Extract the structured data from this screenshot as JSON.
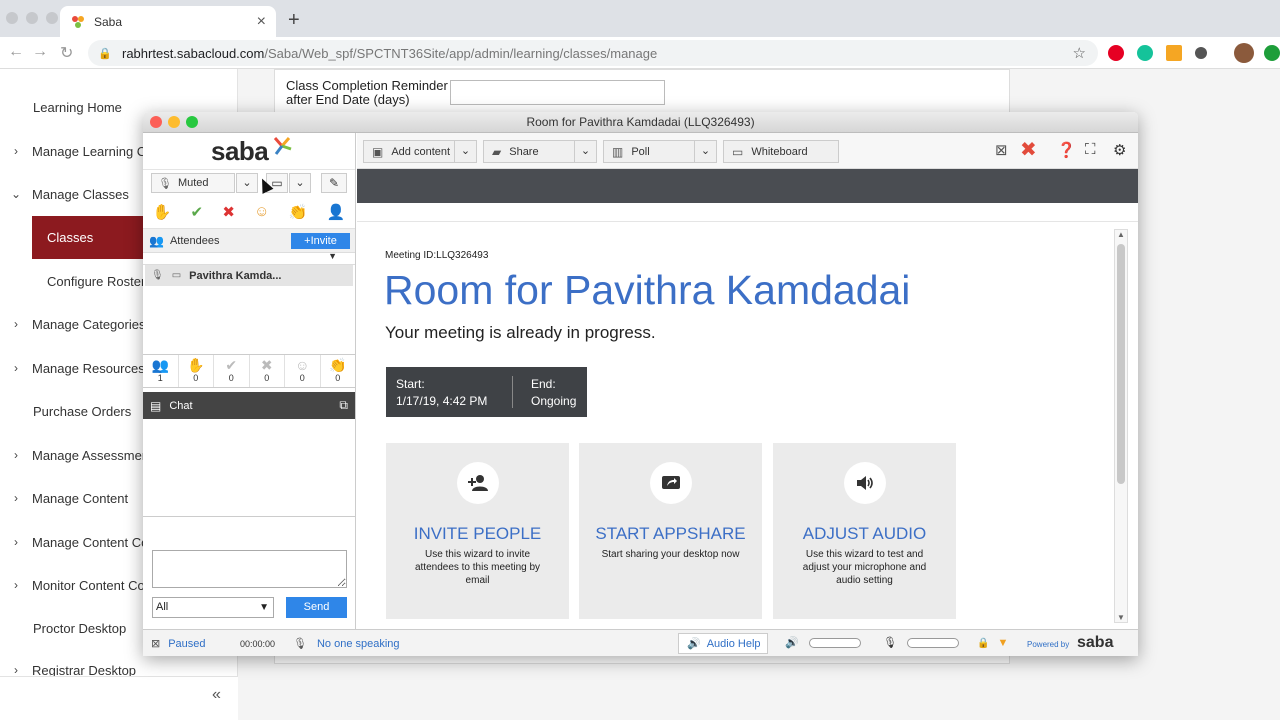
{
  "browser": {
    "tab_title": "Saba",
    "url_host": "rabhrtest.sabacloud.com",
    "url_path": "/Saba/Web_spf/SPCTNT36Site/app/admin/learning/classes/manage"
  },
  "sidebar": {
    "items": [
      {
        "label": "Learning Home"
      },
      {
        "label": "Manage Learning Ca"
      },
      {
        "label": "Manage Classes"
      },
      {
        "label": "Classes"
      },
      {
        "label": "Configure Roster"
      },
      {
        "label": "Manage Categories"
      },
      {
        "label": "Manage Resources"
      },
      {
        "label": "Purchase Orders"
      },
      {
        "label": "Manage Assessmen"
      },
      {
        "label": "Manage Content"
      },
      {
        "label": "Manage Content Co"
      },
      {
        "label": "Monitor Content Co"
      },
      {
        "label": "Proctor Desktop"
      },
      {
        "label": "Registrar Desktop"
      }
    ]
  },
  "page": {
    "field_label_1": "Class Completion Reminder",
    "field_label_2": "after End Date (days)",
    "field_value": ""
  },
  "meeting_window": {
    "title": "Room for Pavithra Kamdadai (LLQ326493)",
    "logo": "saba",
    "mute_label": "Muted",
    "attendees_label": "Attendees",
    "invite_label": "+Invite",
    "attendee_name": "Pavithra Kamda...",
    "counts": [
      "1",
      "0",
      "0",
      "0",
      "0",
      "0"
    ],
    "chat_label": "Chat",
    "chat_input": "",
    "chat_select": "All",
    "send_label": "Send",
    "toolbar": {
      "add_content": "Add content",
      "share": "Share",
      "poll": "Poll",
      "whiteboard": "Whiteboard"
    },
    "stage": {
      "meeting_id": "Meeting ID:LLQ326493",
      "room_title": "Room for Pavithra Kamdadai",
      "subtitle": "Your meeting is already in progress.",
      "start_label": "Start:",
      "start_value": "1/17/19, 4:42 PM",
      "end_label": "End:",
      "end_value": "Ongoing",
      "cards": [
        {
          "title": "INVITE PEOPLE",
          "desc": "Use this wizard to invite attendees to this meeting by email",
          "icon": "add-person-icon"
        },
        {
          "title": "START APPSHARE",
          "desc": "Start sharing your desktop now",
          "icon": "screen-share-icon"
        },
        {
          "title": "ADJUST AUDIO",
          "desc": "Use this wizard to test and adjust your microphone and audio setting",
          "icon": "speaker-icon"
        }
      ]
    },
    "status": {
      "recording": "Paused",
      "timer": "00:00:00",
      "speaking": "No one speaking",
      "audio_help": "Audio Help",
      "powered_by": "Powered by",
      "brand": "saba"
    }
  },
  "colors": {
    "accent_blue": "#3c6fc6",
    "button_blue": "#2f86e8",
    "active_nav": "#8c1a1f"
  }
}
